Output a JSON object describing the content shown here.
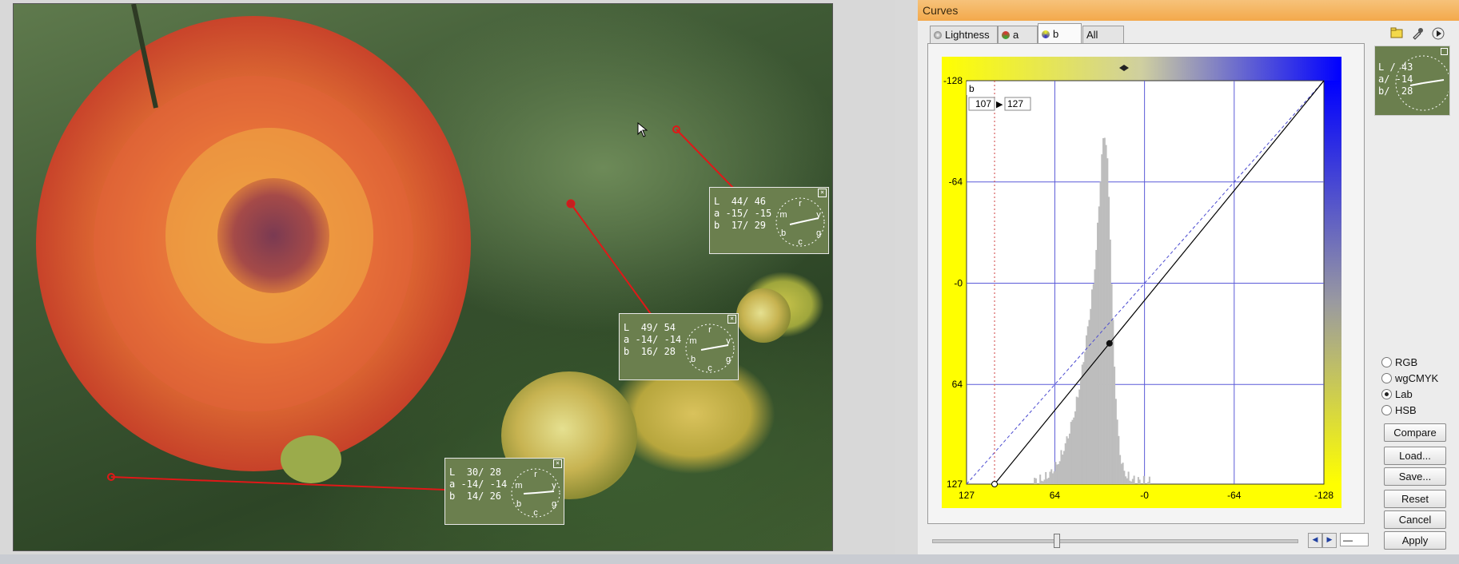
{
  "image_samplers": [
    {
      "L": "44/ 46",
      "a": "-15/ -15",
      "b": "17/ 29"
    },
    {
      "L": "49/ 54",
      "a": "-14/ -14",
      "b": "16/ 28"
    },
    {
      "L": "30/ 28",
      "a": "-14/ -14",
      "b": "14/ 26"
    }
  ],
  "wheel_labels": {
    "top": "r",
    "left": "m",
    "right": "y",
    "bottom_left": "b",
    "bottom": "c",
    "bottom_right": "g"
  },
  "dialog": {
    "title": "Curves",
    "tabs": [
      {
        "label": "Lightness",
        "active": false
      },
      {
        "label": "a",
        "active": false
      },
      {
        "label": "b",
        "active": true
      },
      {
        "label": "All",
        "active": false
      }
    ],
    "channel_label": "b",
    "input_value": "107",
    "output_value": "127",
    "arrow_glyph": "▶",
    "y_axis_labels": [
      "-128",
      "-64",
      "-0",
      "64",
      "127"
    ],
    "x_axis_labels": [
      "127",
      "64",
      "-0",
      "-64",
      "-128"
    ],
    "mini_readout": {
      "L": "L / 43",
      "a": "a/ -14",
      "b": "b/  28"
    },
    "color_modes": [
      {
        "label": "RGB",
        "selected": false
      },
      {
        "label": "wgCMYK",
        "selected": false
      },
      {
        "label": "Lab",
        "selected": true
      },
      {
        "label": "HSB",
        "selected": false
      }
    ],
    "buttons": {
      "compare": "Compare",
      "load": "Load...",
      "save": "Save...",
      "reset": "Reset",
      "cancel": "Cancel",
      "apply": "Apply"
    },
    "slider_value": "—",
    "icons": [
      "folder-icon",
      "eyedropper-icon",
      "play-icon"
    ],
    "colors": {
      "accent_title": "#f3a94b",
      "sampler_line": "#e01818",
      "grid": "#5a5ad8",
      "readout_bg": "#6b7f4e"
    }
  }
}
